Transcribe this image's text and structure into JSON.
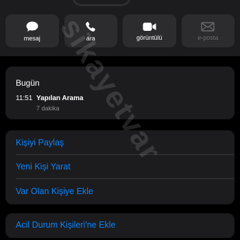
{
  "actions": [
    {
      "label": "mesaj",
      "icon": "message-icon",
      "enabled": true
    },
    {
      "label": "ara",
      "icon": "phone-icon",
      "enabled": true
    },
    {
      "label": "görüntülü",
      "icon": "video-camera-icon",
      "enabled": true
    },
    {
      "label": "e-posta",
      "icon": "mail-icon",
      "enabled": false
    }
  ],
  "history": {
    "title": "Bugün",
    "time": "11:51",
    "type": "Yapılan Arama",
    "duration": "7 dakika"
  },
  "contact_actions": {
    "share": "Kişiyi Paylaş",
    "new_contact": "Yeni Kişi Yarat",
    "add_existing": "Var Olan Kişiye Ekle"
  },
  "emergency": {
    "label": "Acil Durum Kişileri'ne Ekle"
  },
  "watermark": "sikayetvar",
  "colors": {
    "background": "#000000",
    "card": "#1c1c1e",
    "button": "#2c2c2e",
    "accent": "#0a84ff",
    "secondary_text": "#8e8e93"
  }
}
